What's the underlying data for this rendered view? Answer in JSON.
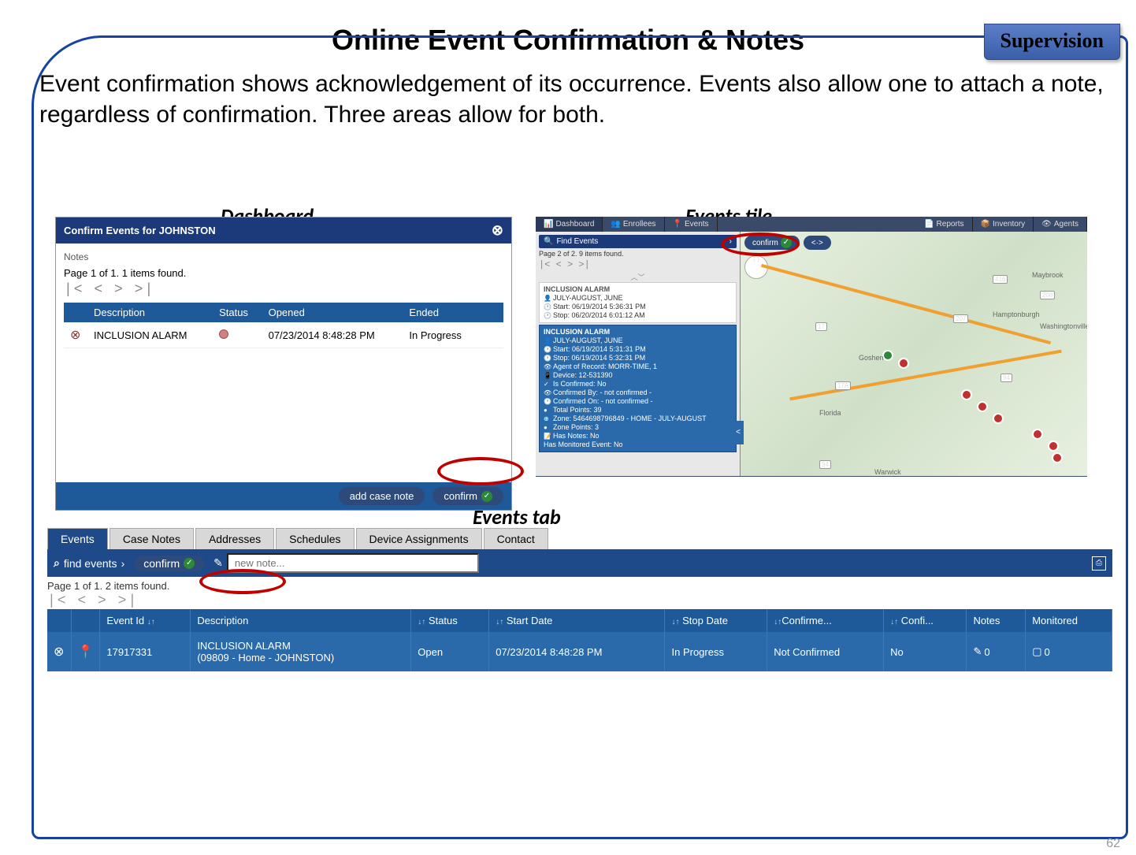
{
  "badge": "Supervision",
  "title": "Online Event Confirmation & Notes",
  "intro": "Event confirmation shows acknowledgement of its occurrence. Events also allow one to attach a note, regardless of confirmation. Three areas allow for both.",
  "labels": {
    "dashboard": "Dashboard",
    "events_tile": "Events tile",
    "events_tab": "Events tab"
  },
  "dashboard": {
    "header": "Confirm Events for JOHNSTON",
    "notes": "Notes",
    "page_info": "Page 1 of 1. 1 items found.",
    "columns": {
      "desc": "Description",
      "status": "Status",
      "opened": "Opened",
      "ended": "Ended"
    },
    "row": {
      "desc": "INCLUSION ALARM",
      "opened": "07/23/2014 8:48:28 PM",
      "ended": "In Progress"
    },
    "add_case_note": "add case note",
    "confirm": "confirm"
  },
  "tile": {
    "tabs": {
      "dashboard": "Dashboard",
      "enrollees": "Enrollees",
      "events": "Events",
      "reports": "Reports",
      "inventory": "Inventory",
      "agents": "Agents"
    },
    "find": "Find Events",
    "page_info": "Page 2 of 2. 9 items found.",
    "card1": {
      "title": "INCLUSION ALARM",
      "person": "JULY-AUGUST, JUNE",
      "start": "Start: 06/19/2014 5:36:31 PM",
      "stop": "Stop: 06/20/2014 6:01:12 AM"
    },
    "card2": {
      "title": "INCLUSION ALARM",
      "person": "JULY-AUGUST, JUNE",
      "start": "Start: 06/19/2014 5:31:31 PM",
      "stop": "Stop: 06/19/2014 5:32:31 PM",
      "agent": "Agent of Record: MORR-TIME, 1",
      "device": "Device: 12-531390",
      "confirmed": "Is Confirmed: No",
      "confby": "Confirmed By: - not confirmed -",
      "confon": "Confirmed On: - not confirmed -",
      "total": "Total Points: 39",
      "zone": "Zone: 5464698796849 - HOME - JULY-AUGUST",
      "zonepts": "Zone Points: 3",
      "hasnotes": "Has Notes: No",
      "monitored": "Has Monitored Event: No"
    },
    "map": {
      "confirm": "confirm"
    }
  },
  "events_tab": {
    "tabs": {
      "events": "Events",
      "case_notes": "Case Notes",
      "addresses": "Addresses",
      "schedules": "Schedules",
      "device": "Device Assignments",
      "contact": "Contact"
    },
    "find": "find events",
    "confirm": "confirm",
    "new_note": "new note...",
    "page_info": "Page 1 of 1. 2 items found.",
    "columns": {
      "event_id": "Event Id",
      "desc": "Description",
      "status": "Status",
      "start": "Start Date",
      "stop": "Stop Date",
      "confirmed": "Confirme...",
      "confi": "Confi...",
      "notes": "Notes",
      "monitored": "Monitored"
    },
    "row": {
      "event_id": "17917331",
      "desc1": "INCLUSION ALARM",
      "desc2": "(09809 - Home - JOHNSTON)",
      "status": "Open",
      "start": "07/23/2014 8:48:28 PM",
      "stop": "In Progress",
      "confirmed": "Not Confirmed",
      "confi": "No",
      "notes": "0",
      "monitored": "0"
    }
  },
  "page_number": "62"
}
